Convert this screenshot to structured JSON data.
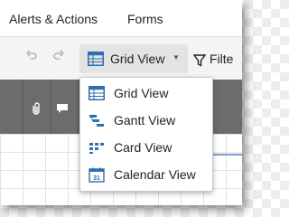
{
  "menubar": {
    "items": [
      {
        "label": "Alerts & Actions"
      },
      {
        "label": "Forms"
      }
    ]
  },
  "toolbar": {
    "undo_icon": "undo-icon",
    "redo_icon": "redo-icon",
    "view_button": {
      "label": "Grid View",
      "icon": "grid-view-icon"
    },
    "filter": {
      "label": "Filte",
      "icon": "filter-icon"
    }
  },
  "grid": {
    "header_icons": [
      "attachment-icon",
      "comment-icon"
    ]
  },
  "view_menu": {
    "items": [
      {
        "label": "Grid View",
        "icon": "grid-view-icon"
      },
      {
        "label": "Gantt View",
        "icon": "gantt-view-icon"
      },
      {
        "label": "Card View",
        "icon": "card-view-icon"
      },
      {
        "label": "Calendar View",
        "icon": "calendar-view-icon",
        "icon_text": "31"
      }
    ]
  },
  "colors": {
    "icon_blue": "#2f6fb0",
    "header_gray": "#6c6c6c",
    "button_gray": "#e3e3e3"
  }
}
